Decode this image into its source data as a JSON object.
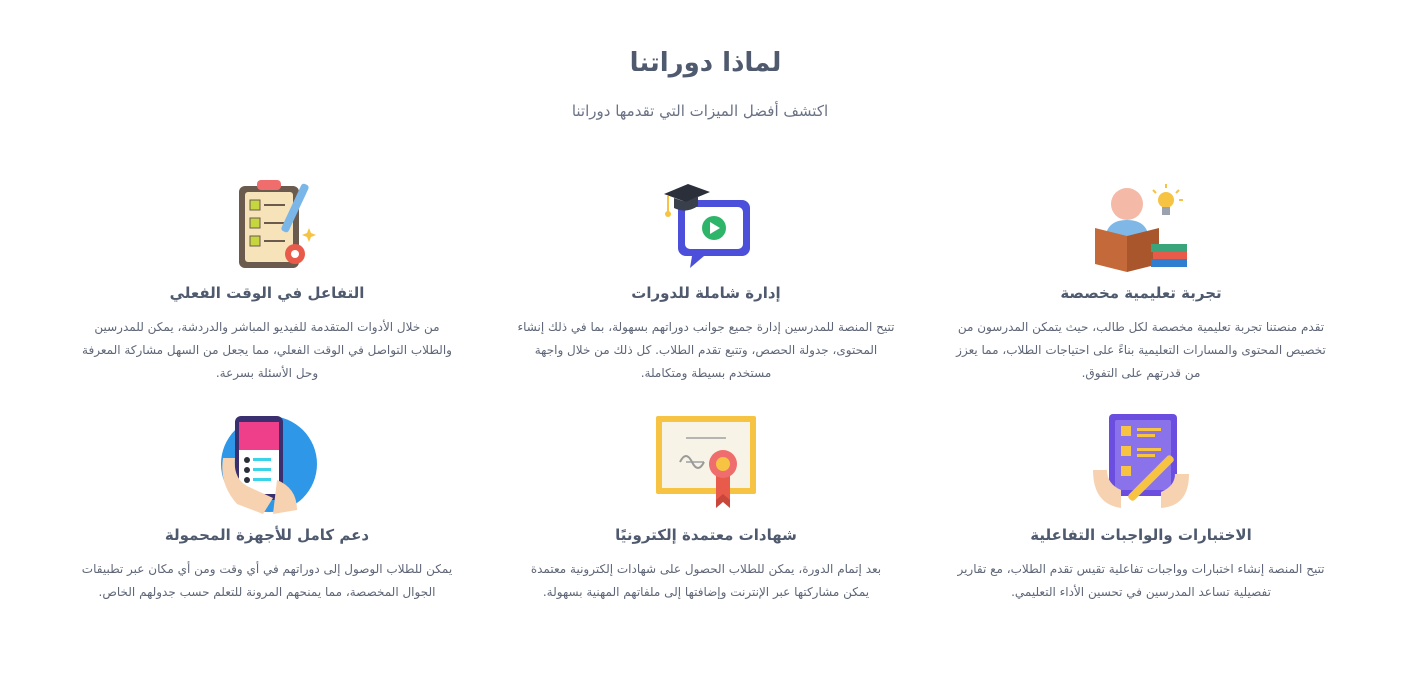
{
  "section": {
    "title": "لماذا دوراتنا",
    "subtitle": "اكتشف أفضل الميزات التي تقدمها دوراتنا"
  },
  "features": [
    {
      "icon": "reading-student-lightbulb-icon",
      "title": "تجربة تعليمية مخصصة",
      "description": "تقدم منصتنا تجربة تعليمية مخصصة لكل طالب، حيث يتمكن المدرسون من تخصيص المحتوى والمسارات التعليمية بناءً على احتياجات الطلاب، مما يعزز من قدرتهم على التفوق."
    },
    {
      "icon": "graduation-video-icon",
      "title": "إدارة شاملة للدورات",
      "description": "تتيح المنصة للمدرسين إدارة جميع جوانب دوراتهم بسهولة، بما في ذلك إنشاء المحتوى، جدولة الحصص، وتتبع تقدم الطلاب. كل ذلك من خلال واجهة مستخدم بسيطة ومتكاملة."
    },
    {
      "icon": "checklist-clipboard-icon",
      "title": "التفاعل في الوقت الفعلي",
      "description": "من خلال الأدوات المتقدمة للفيديو المباشر والدردشة، يمكن للمدرسين والطلاب التواصل في الوقت الفعلي، مما يجعل من السهل مشاركة المعرفة وحل الأسئلة بسرعة."
    },
    {
      "icon": "quiz-notebook-icon",
      "title": "الاختبارات والواجبات التفاعلية",
      "description": "تتيح المنصة إنشاء اختبارات وواجبات تفاعلية تقيس تقدم الطلاب، مع تقارير تفصيلية تساعد المدرسين في تحسين الأداء التعليمي."
    },
    {
      "icon": "certificate-icon",
      "title": "شهادات معتمدة إلكترونيًا",
      "description": "بعد إتمام الدورة، يمكن للطلاب الحصول على شهادات إلكترونية معتمدة يمكن مشاركتها عبر الإنترنت وإضافتها إلى ملفاتهم المهنية بسهولة."
    },
    {
      "icon": "mobile-phone-hand-icon",
      "title": "دعم كامل للأجهزة المحمولة",
      "description": "يمكن للطلاب الوصول إلى دوراتهم في أي وقت ومن أي مكان عبر تطبيقات الجوال المخصصة، مما يمنحهم المرونة للتعلم حسب جدولهم الخاص."
    }
  ]
}
